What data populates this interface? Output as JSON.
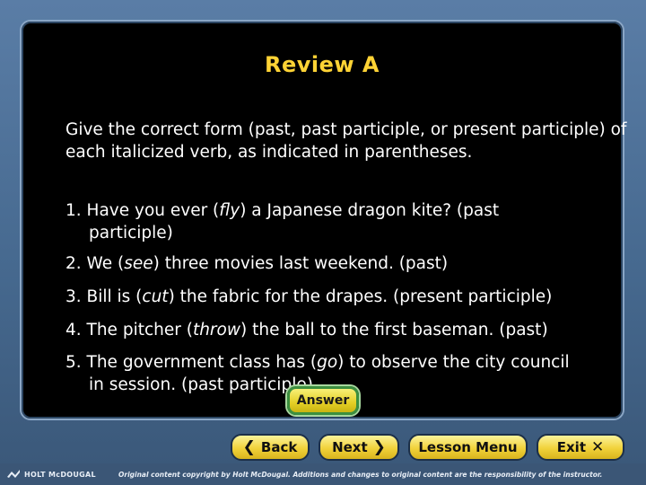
{
  "title": "Review A",
  "intro": "Give the correct form (past, past participle, or present participle) of each italicized verb, as indicated in parentheses.",
  "questions": [
    {
      "pre": "1. Have you ever (",
      "verb": "fly",
      "post": ") a Japanese dragon kite? (past",
      "cont": "participle)"
    },
    {
      "pre": "2. We (",
      "verb": "see",
      "post": ") three movies last weekend. (past)"
    },
    {
      "pre": "3. Bill is (",
      "verb": "cut",
      "post": ") the fabric for the drapes. (present participle)"
    },
    {
      "pre": "4. The pitcher (",
      "verb": "throw",
      "post": ") the ball to the first baseman. (past)"
    },
    {
      "pre": "5. The government class has (",
      "verb": "go",
      "post": ") to observe the city council",
      "cont": "in session. (past participle)"
    }
  ],
  "answer_label": "Answer",
  "nav": {
    "back": "Back",
    "next": "Next",
    "lesson_menu": "Lesson Menu",
    "exit": "Exit"
  },
  "footer": {
    "brand": "HOLT McDOUGAL",
    "copyright": "Original content copyright by Holt McDougal. Additions and changes to original content are the responsibility of the instructor."
  },
  "colors": {
    "title": "#ffd335",
    "panel": "#000000",
    "button": "#f1d23a",
    "footer": "#3b5676"
  }
}
